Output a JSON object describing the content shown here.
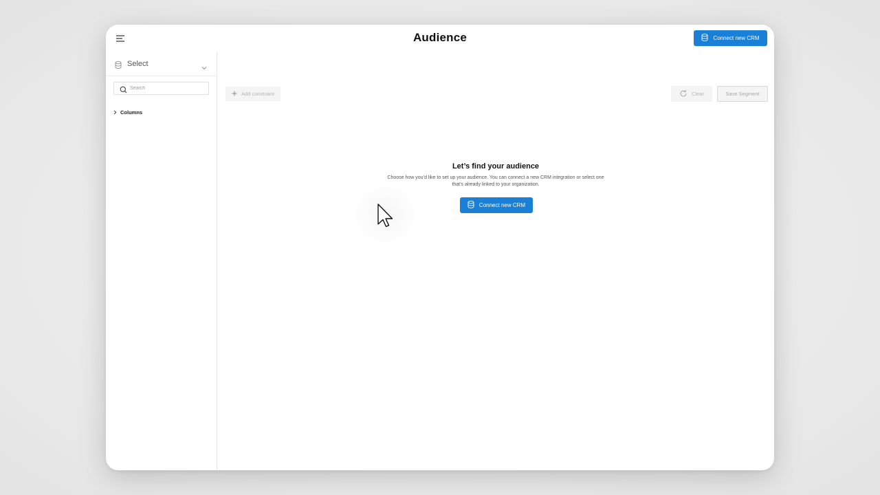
{
  "header": {
    "title": "Audience",
    "connect_crm_label": "Connect new CRM",
    "menu_icon": "hamburger-menu-icon"
  },
  "sidebar": {
    "select_label": "Select",
    "search_placeholder": "Search",
    "columns_label": "Columns"
  },
  "toolbar": {
    "add_constraint_label": "Add constraint",
    "clear_label": "Clear",
    "save_segment_label": "Save Segment"
  },
  "empty_state": {
    "title": "Let’s find your audience",
    "description": "Choose how you’d like to set up your audience. You can connect a new CRM integration or select one that’s already linked to your organization.",
    "button_label": "Connect new CRM"
  },
  "colors": {
    "primary": "#1a7fd6",
    "background": "#ebebeb",
    "window": "#ffffff",
    "disabled_text": "#b5b5b5"
  }
}
